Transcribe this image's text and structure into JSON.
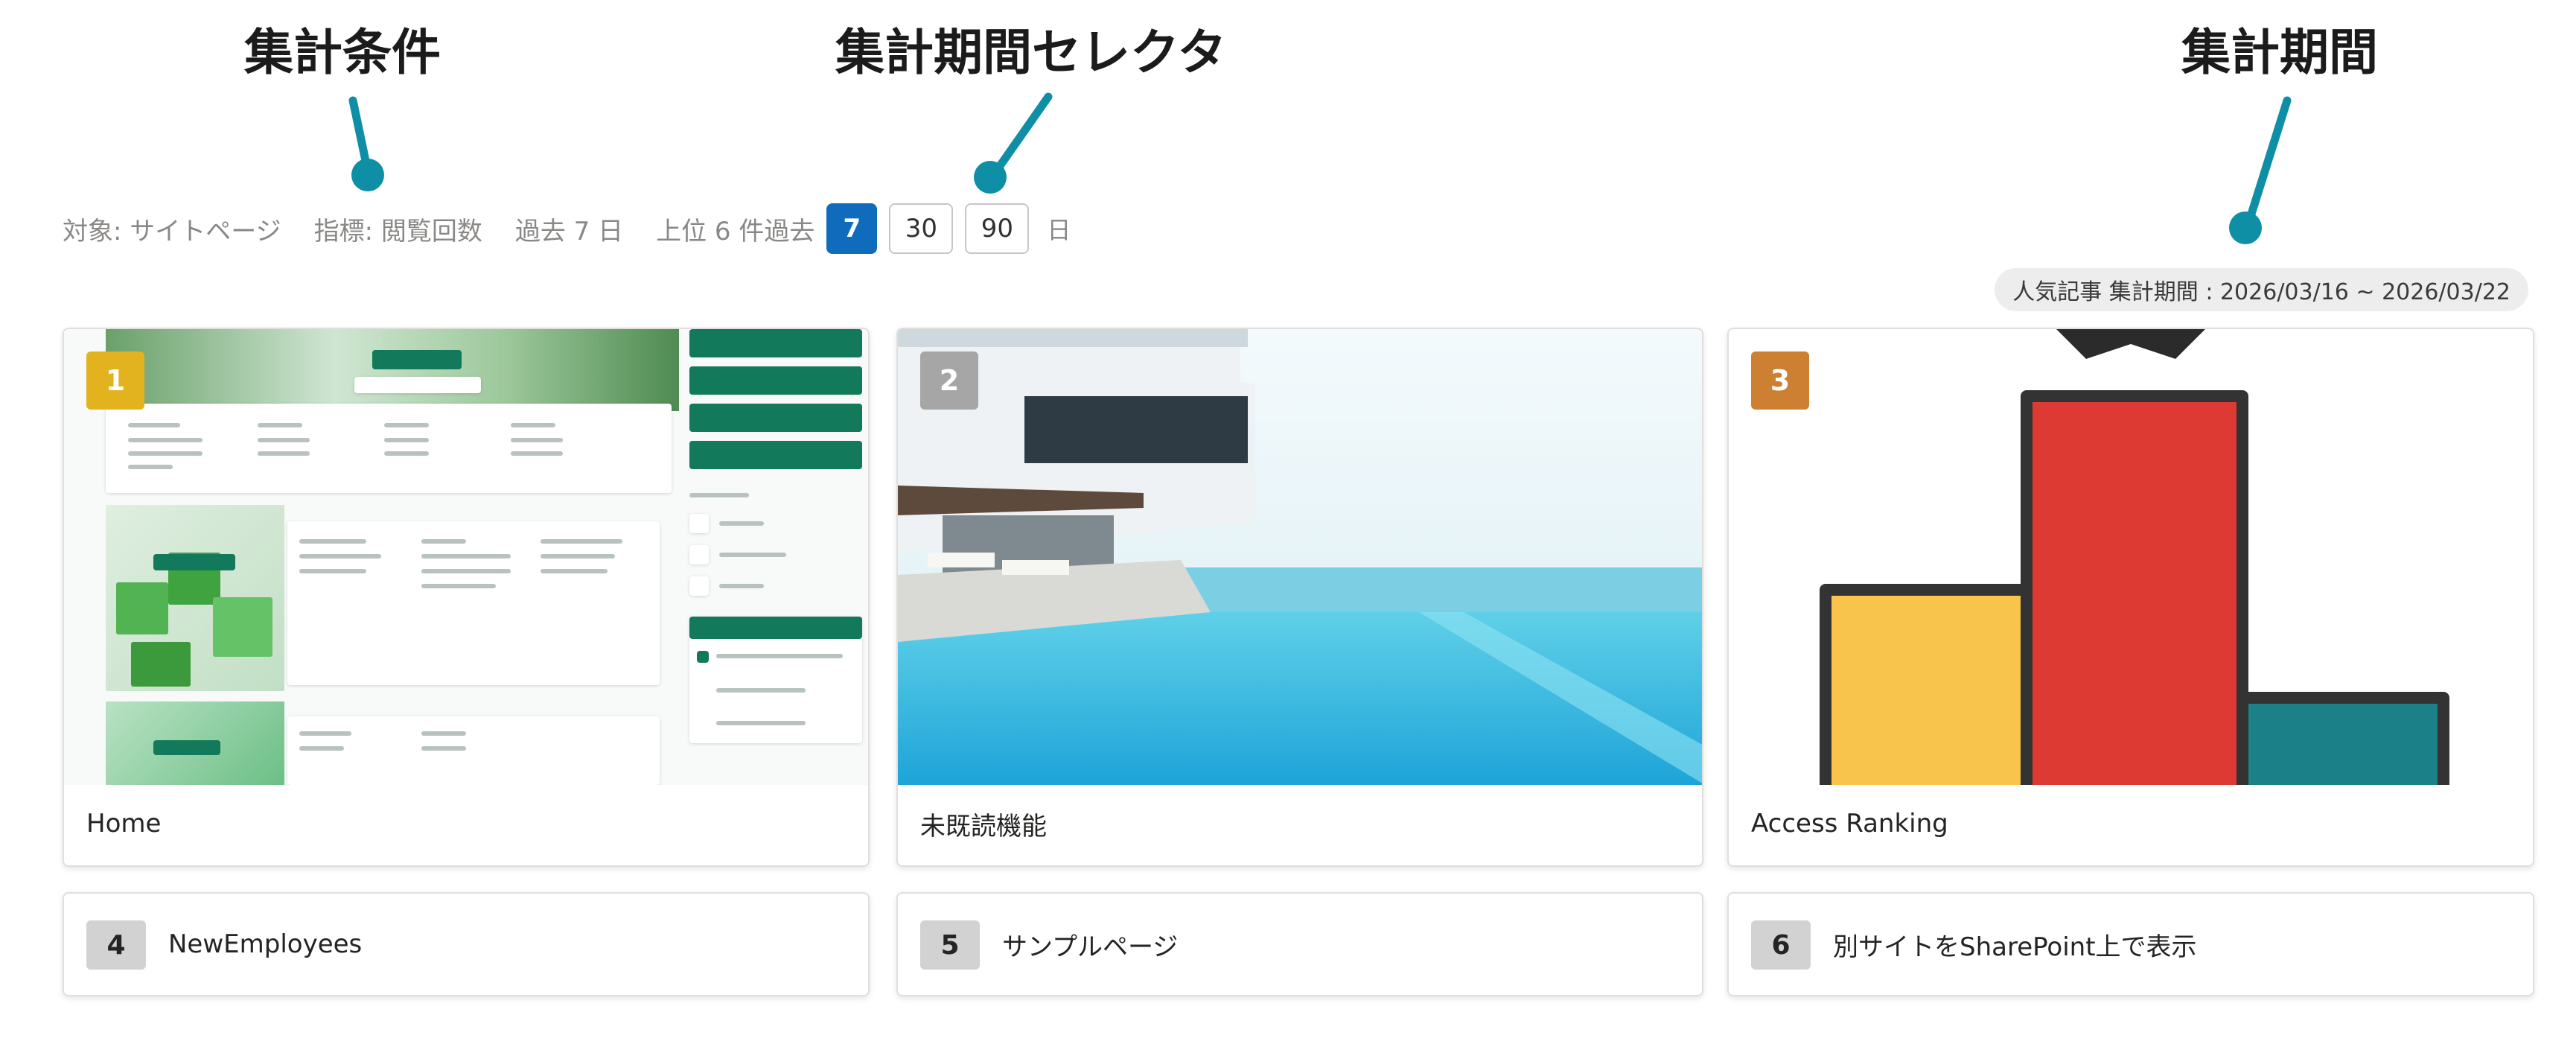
{
  "annotations": {
    "criteria_label": "集計条件",
    "selector_label": "集計期間セレクタ",
    "period_label": "集計期間"
  },
  "toolbar": {
    "target": "対象: サイトページ",
    "metric": "指標: 閲覧回数",
    "range": "過去 7 日",
    "top": "上位 6 件",
    "past_label": "過去",
    "periods": [
      "7",
      "30",
      "90"
    ],
    "selected_period": "7",
    "unit": "日"
  },
  "period_badge": "人気記事 集計期間 : 2026/03/16 ~ 2026/03/22",
  "cards": [
    {
      "rank": "1",
      "title": "Home",
      "rank_color": "#e3b21f"
    },
    {
      "rank": "2",
      "title": "未既読機能",
      "rank_color": "#a6a6a6"
    },
    {
      "rank": "3",
      "title": "Access Ranking",
      "rank_color": "#cd7f32"
    }
  ],
  "small_cards": [
    {
      "rank": "4",
      "title": "NewEmployees"
    },
    {
      "rank": "5",
      "title": "サンプルページ"
    },
    {
      "rank": "6",
      "title": "別サイトをSharePoint上で表示"
    }
  ],
  "colors": {
    "accent": "#0f6cbd",
    "callout": "#0f8fa6",
    "gold": "#e3b21f",
    "silver": "#a6a6a6",
    "bronze": "#cd7f32"
  }
}
